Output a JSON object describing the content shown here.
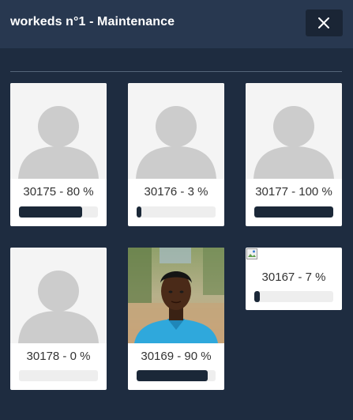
{
  "modal": {
    "title": "workeds n°1 - Maintenance",
    "close_icon": "close-icon"
  },
  "workers": [
    {
      "id": "30175",
      "percent": 80,
      "label": "30175 - 80 %",
      "photo": "default-avatar-icon"
    },
    {
      "id": "30176",
      "percent": 3,
      "label": "30176 - 3 %",
      "photo": "default-avatar-icon"
    },
    {
      "id": "30177",
      "percent": 100,
      "label": "30177 - 100 %",
      "photo": "default-avatar-icon"
    },
    {
      "id": "30178",
      "percent": 0,
      "label": "30178 - 0 %",
      "photo": "default-avatar-icon"
    },
    {
      "id": "30169",
      "percent": 90,
      "label": "30169 - 90 %",
      "photo": "person-photo"
    },
    {
      "id": "30167",
      "percent": 7,
      "label": "30167 - 7 %",
      "photo": "broken-image-icon"
    }
  ],
  "colors": {
    "background": "#1e2c40",
    "header": "#283850",
    "progress_fill": "#1b2838",
    "progress_track": "#eeeeee",
    "avatar_gray": "#cccccc"
  }
}
